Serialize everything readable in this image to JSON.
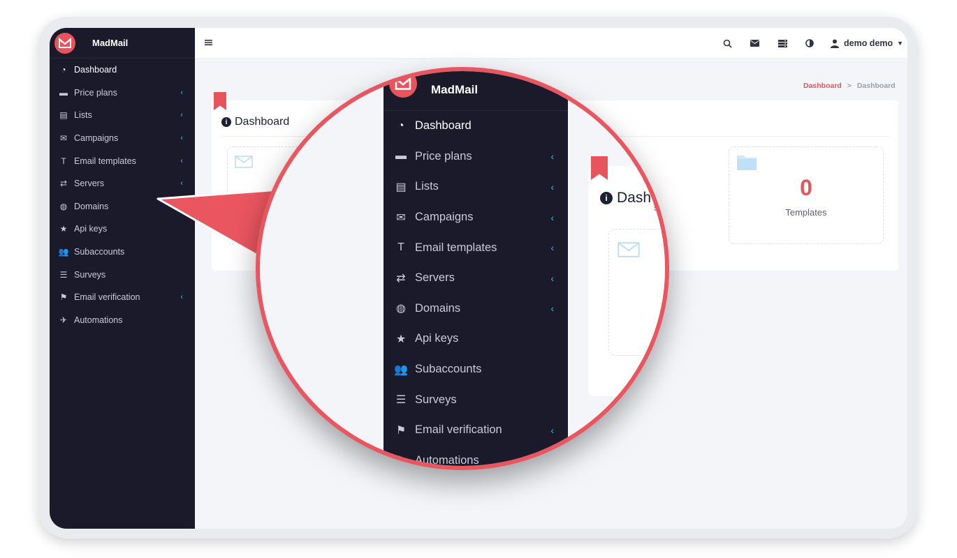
{
  "brand": {
    "name": "MadMail"
  },
  "sidebar": {
    "items": [
      {
        "label": "Dashboard",
        "icon": "dashboard-gauge-icon",
        "active": true,
        "submenu": false
      },
      {
        "label": "Price plans",
        "icon": "credit-card-icon",
        "submenu": true
      },
      {
        "label": "Lists",
        "icon": "list-document-icon",
        "submenu": true
      },
      {
        "label": "Campaigns",
        "icon": "envelope-icon",
        "submenu": true
      },
      {
        "label": "Email templates",
        "icon": "text-format-icon",
        "submenu": true
      },
      {
        "label": "Servers",
        "icon": "exchange-arrows-icon",
        "submenu": true
      },
      {
        "label": "Domains",
        "icon": "globe-icon",
        "submenu": false
      },
      {
        "label": "Api keys",
        "icon": "star-icon",
        "submenu": false
      },
      {
        "label": "Subaccounts",
        "icon": "users-icon",
        "submenu": false
      },
      {
        "label": "Surveys",
        "icon": "list-bullets-icon",
        "submenu": false
      },
      {
        "label": "Email verification",
        "icon": "check-flag-icon",
        "submenu": true
      },
      {
        "label": "Automations",
        "icon": "plane-icon",
        "submenu": false
      }
    ]
  },
  "magnifier": {
    "items": [
      {
        "label": "Dashboard",
        "active": true,
        "submenu": false
      },
      {
        "label": "Price plans",
        "submenu": true
      },
      {
        "label": "Lists",
        "submenu": true
      },
      {
        "label": "Campaigns",
        "submenu": true
      },
      {
        "label": "Email templates",
        "submenu": true
      },
      {
        "label": "Servers",
        "submenu": true
      },
      {
        "label": "Domains",
        "submenu": true
      },
      {
        "label": "Api keys",
        "submenu": false
      },
      {
        "label": "Subaccounts",
        "submenu": false
      },
      {
        "label": "Surveys",
        "submenu": false
      },
      {
        "label": "Email verification",
        "submenu": true
      },
      {
        "label": "Automations",
        "submenu": false
      }
    ],
    "card_title": "Dash",
    "partial_label": "s"
  },
  "topbar": {
    "user_name": "demo demo",
    "icons": [
      "search-icon",
      "envelope-icon",
      "server-icon",
      "contrast-icon",
      "user-icon"
    ]
  },
  "breadcrumb": {
    "root": "Dashboard",
    "separator": ">",
    "current": "Dashboard"
  },
  "dashboard": {
    "title": "Dashboard",
    "stats": [
      {
        "value": "0",
        "label": "Templates"
      }
    ]
  },
  "colors": {
    "sidebar_bg": "#1b1a2b",
    "accent": "#e8545c",
    "chevron": "#2bc4d6",
    "content_bg": "#f3f5f9"
  }
}
